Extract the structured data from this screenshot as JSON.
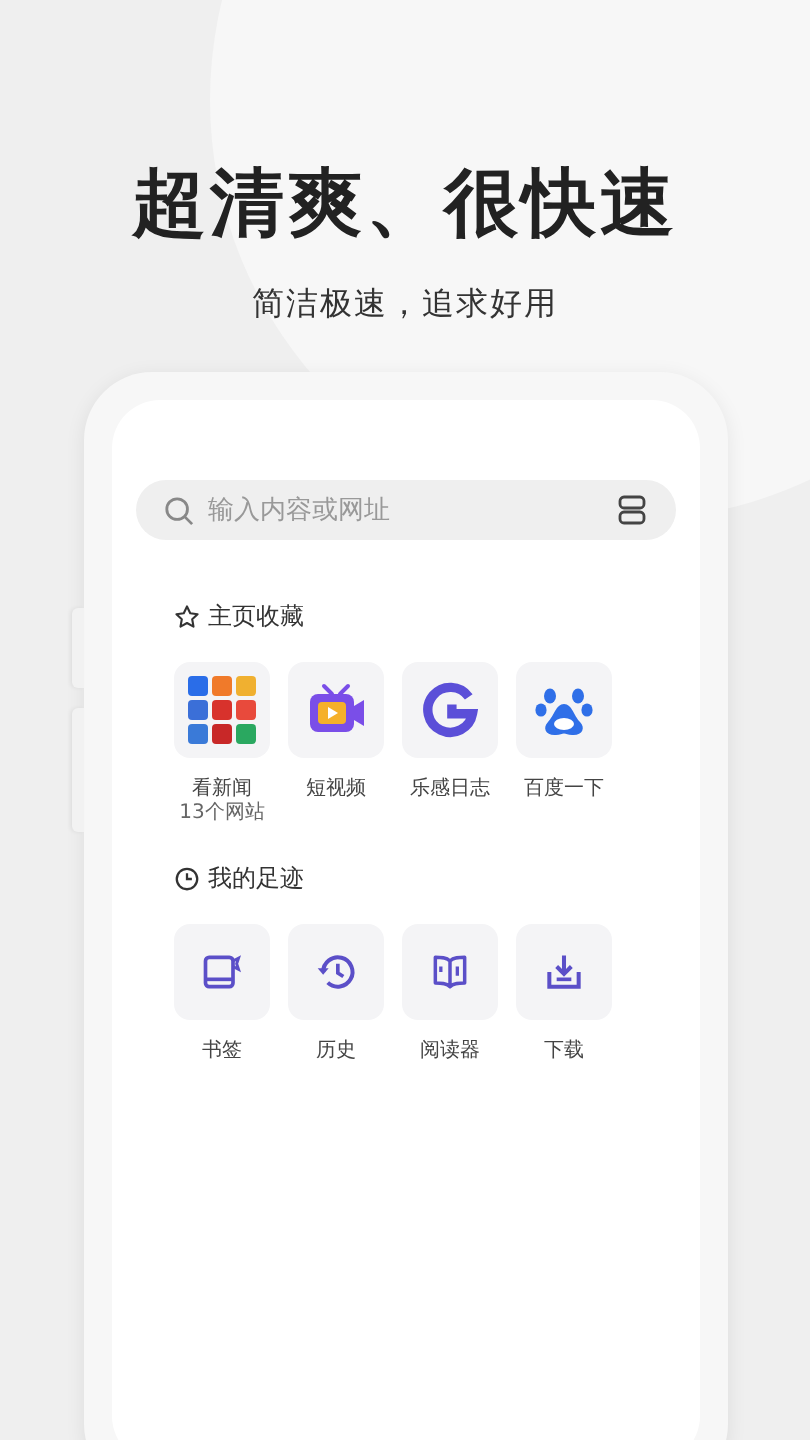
{
  "headline": "超清爽、很快速",
  "subtitle": "简洁极速，追求好用",
  "search": {
    "placeholder": "输入内容或网址"
  },
  "sections": [
    {
      "kind": "favorites",
      "title": "主页收藏",
      "items": [
        {
          "kind": "news-grid",
          "label": "看新闻",
          "sublabel": "13个网站"
        },
        {
          "kind": "video",
          "label": "短视频"
        },
        {
          "kind": "g-logo",
          "label": "乐感日志"
        },
        {
          "kind": "paw",
          "label": "百度一下"
        }
      ]
    },
    {
      "kind": "footprints",
      "title": "我的足迹",
      "items": [
        {
          "kind": "bookmark",
          "label": "书签"
        },
        {
          "kind": "history",
          "label": "历史"
        },
        {
          "kind": "reader",
          "label": "阅读器"
        },
        {
          "kind": "download",
          "label": "下载"
        }
      ]
    }
  ]
}
